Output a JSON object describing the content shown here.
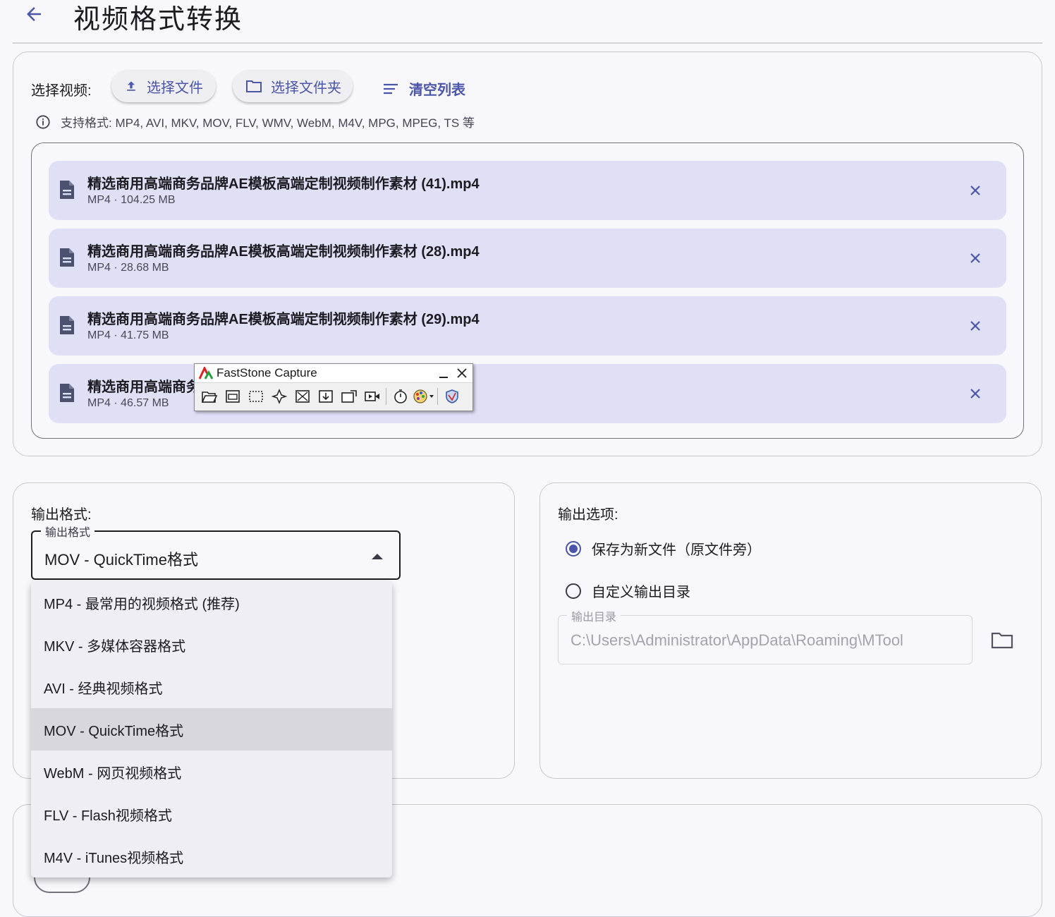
{
  "header": {
    "title": "视频格式转换",
    "back_icon": "arrow-left-icon"
  },
  "input": {
    "label": "选择视频:",
    "select_file": "选择文件",
    "select_folder": "选择文件夹",
    "clear_list": "清空列表",
    "hint": "支持格式: MP4, AVI, MKV, MOV, FLV, WMV, WebM, M4V, MPG, MPEG, TS 等"
  },
  "files": [
    {
      "name": "精选商用高端商务品牌AE模板高端定制视频制作素材 (41).mp4",
      "meta": "MP4 · 104.25 MB"
    },
    {
      "name": "精选商用高端商务品牌AE模板高端定制视频制作素材 (28).mp4",
      "meta": "MP4 · 28.68 MB"
    },
    {
      "name": "精选商用高端商务品牌AE模板高端定制视频制作素材 (29).mp4",
      "meta": "MP4 · 41.75 MB"
    },
    {
      "name": "精选商用高端商务",
      "meta": "MP4 · 46.57 MB"
    }
  ],
  "output_format": {
    "label": "输出格式:",
    "field_label": "输出格式",
    "selected": "MOV - QuickTime格式",
    "options": [
      "MP4 - 最常用的视频格式 (推荐)",
      "MKV - 多媒体容器格式",
      "AVI - 经典视频格式",
      "MOV - QuickTime格式",
      "WebM - 网页视频格式",
      "FLV - Flash视频格式",
      "M4V - iTunes视频格式"
    ]
  },
  "output_options": {
    "label": "输出选项:",
    "radio_new_file": "保存为新文件（原文件旁）",
    "radio_custom_dir": "自定义输出目录",
    "dir_label": "输出目录",
    "dir_value": "C:\\Users\\Administrator\\AppData\\Roaming\\MTool"
  },
  "faststone": {
    "title": "FastStone Capture"
  },
  "colors": {
    "accent": "#4b56a8",
    "item_bg": "#dfe0f6",
    "menu_bg": "#efeef4",
    "menu_selected": "#d9d7de"
  }
}
